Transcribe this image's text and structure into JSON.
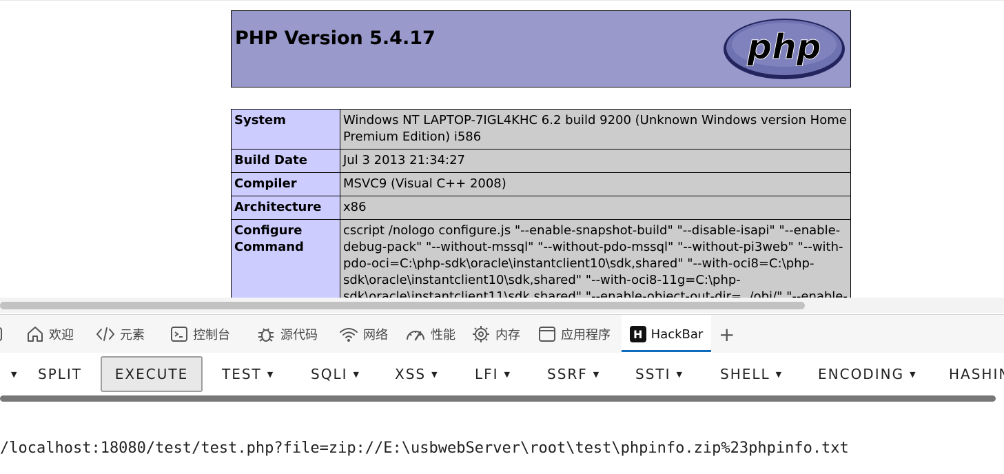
{
  "phpinfo": {
    "title": "PHP Version 5.4.17",
    "logo_text": "php",
    "rows": [
      {
        "key": "System",
        "value": "Windows NT LAPTOP-7IGL4KHC 6.2 build 9200 (Unknown Windows version Home Premium Edition) i586"
      },
      {
        "key": "Build Date",
        "value": "Jul 3 2013 21:34:27"
      },
      {
        "key": "Compiler",
        "value": "MSVC9 (Visual C++ 2008)"
      },
      {
        "key": "Architecture",
        "value": "x86"
      },
      {
        "key": "Configure Command",
        "value": "cscript /nologo configure.js \"--enable-snapshot-build\" \"--disable-isapi\" \"--enable-debug-pack\" \"--without-mssql\" \"--without-pdo-mssql\" \"--without-pi3web\" \"--with-pdo-oci=C:\\php-sdk\\oracle\\instantclient10\\sdk,shared\" \"--with-oci8=C:\\php-sdk\\oracle\\instantclient10\\sdk,shared\" \"--with-oci8-11g=C:\\php-sdk\\oracle\\instantclient11\\sdk,shared\" \"--enable-object-out-dir=../obj/\" \"--enable-"
      }
    ]
  },
  "devtools": {
    "tabs": [
      {
        "label": "欢迎",
        "icon": "home-icon"
      },
      {
        "label": "元素",
        "icon": "code-icon"
      },
      {
        "label": "控制台",
        "icon": "console-icon"
      },
      {
        "label": "源代码",
        "icon": "bug-icon"
      },
      {
        "label": "网络",
        "icon": "wifi-icon"
      },
      {
        "label": "性能",
        "icon": "gauge-icon"
      },
      {
        "label": "内存",
        "icon": "chip-icon"
      },
      {
        "label": "应用程序",
        "icon": "window-icon"
      },
      {
        "label": "HackBar",
        "icon": "hackbar-logo-icon",
        "active": true
      }
    ],
    "add_tab": "+"
  },
  "hackbar": {
    "buttons": {
      "split": "SPLIT",
      "execute": "EXECUTE",
      "test": "TEST",
      "sqli": "SQLI",
      "xss": "XSS",
      "lfi": "LFI",
      "ssrf": "SSRF",
      "ssti": "SSTI",
      "shell": "SHELL",
      "encoding": "ENCODING",
      "hashing": "HASHING"
    },
    "url": "/localhost:18080/test/test.php?file=zip://E:\\usbwebServer\\root\\test\\phpinfo.zip%23phpinfo.txt"
  },
  "colors": {
    "php_header_bg": "#9999cc",
    "key_cell_bg": "#ccccff",
    "value_cell_bg": "#cccccc",
    "active_tab_underline": "#0f6cbd"
  }
}
